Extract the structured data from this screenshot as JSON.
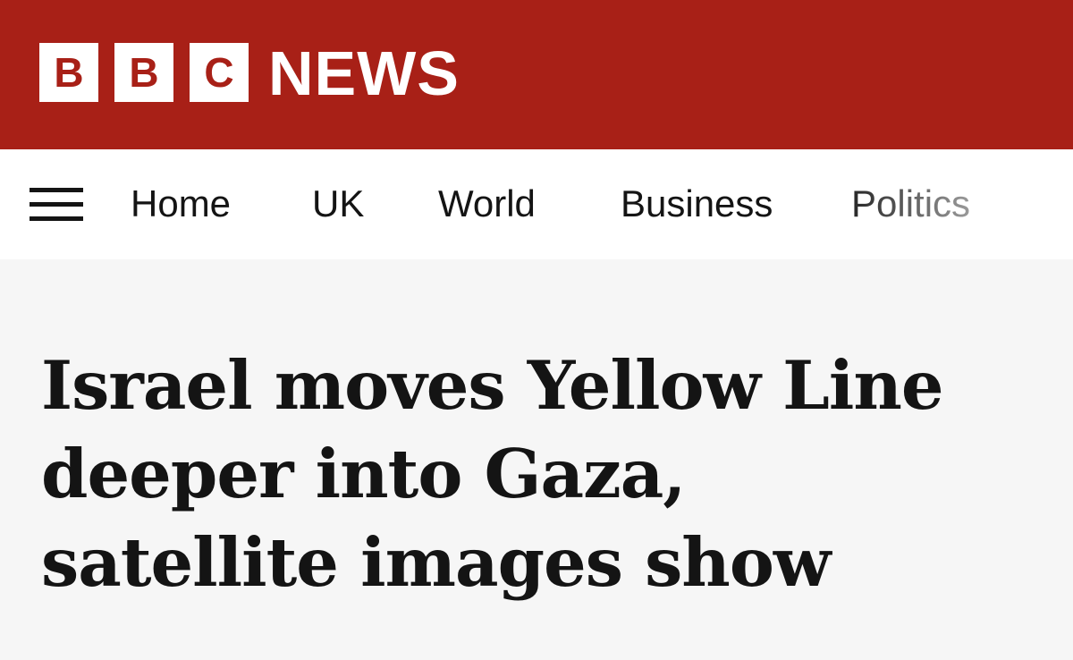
{
  "colors": {
    "brand_red": "#a82017",
    "nav_background": "#ffffff",
    "page_background": "#f6f6f6",
    "text": "#141414"
  },
  "header": {
    "logo_letters": [
      "B",
      "B",
      "C"
    ],
    "logo_word": "NEWS"
  },
  "nav": {
    "menu_icon": "hamburger-menu-icon",
    "items": [
      "Home",
      "UK",
      "World",
      "Business",
      "Politics"
    ]
  },
  "article": {
    "headline_lines": [
      "Israel moves Yellow Line",
      "deeper into Gaza,",
      "satellite images show"
    ]
  }
}
